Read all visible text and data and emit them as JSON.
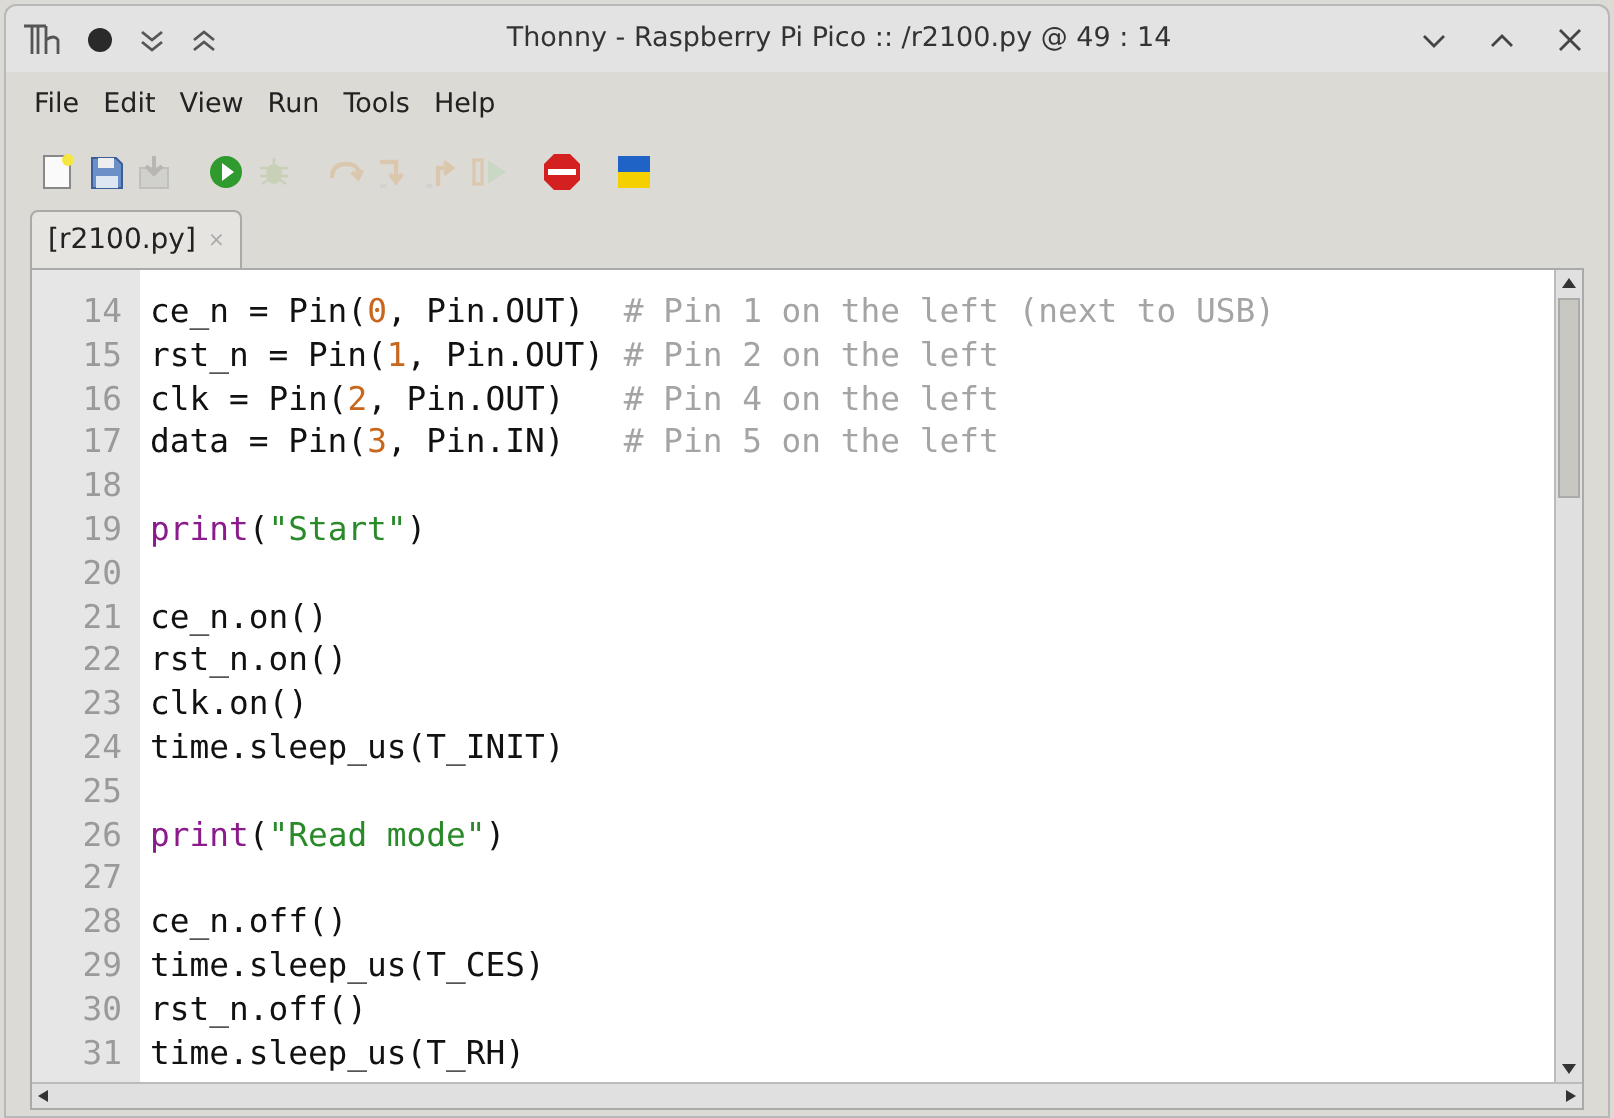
{
  "window": {
    "title": "Thonny - Raspberry Pi Pico :: /r2100.py @ 49 : 14"
  },
  "menu": [
    "File",
    "Edit",
    "View",
    "Run",
    "Tools",
    "Help"
  ],
  "toolbar": [
    {
      "kind": "new",
      "disabled": false
    },
    {
      "kind": "save",
      "disabled": false
    },
    {
      "kind": "load",
      "disabled": true
    },
    {
      "kind": "run",
      "disabled": false
    },
    {
      "kind": "debug",
      "disabled": true
    },
    {
      "kind": "step_over",
      "disabled": true
    },
    {
      "kind": "step_into",
      "disabled": true
    },
    {
      "kind": "step_out",
      "disabled": true
    },
    {
      "kind": "resume",
      "disabled": true
    },
    {
      "kind": "stop",
      "disabled": false
    },
    {
      "kind": "flag",
      "disabled": false
    }
  ],
  "tabs": [
    {
      "label": "[r2100.py]",
      "close": "×",
      "selected": true
    }
  ],
  "editor": {
    "lines": [
      {
        "number": "14",
        "tokens": [
          {
            "kind": "plain",
            "text": "ce_n = Pin("
          },
          {
            "kind": "number",
            "text": "0"
          },
          {
            "kind": "plain",
            "text": ", Pin.OUT)  "
          },
          {
            "kind": "comment",
            "text": "# Pin 1 on the left (next to USB)"
          }
        ]
      },
      {
        "number": "15",
        "tokens": [
          {
            "kind": "plain",
            "text": "rst_n = Pin("
          },
          {
            "kind": "number",
            "text": "1"
          },
          {
            "kind": "plain",
            "text": ", Pin.OUT) "
          },
          {
            "kind": "comment",
            "text": "# Pin 2 on the left"
          }
        ]
      },
      {
        "number": "16",
        "tokens": [
          {
            "kind": "plain",
            "text": "clk = Pin("
          },
          {
            "kind": "number",
            "text": "2"
          },
          {
            "kind": "plain",
            "text": ", Pin.OUT)   "
          },
          {
            "kind": "comment",
            "text": "# Pin 4 on the left"
          }
        ]
      },
      {
        "number": "17",
        "tokens": [
          {
            "kind": "plain",
            "text": "data = Pin("
          },
          {
            "kind": "number",
            "text": "3"
          },
          {
            "kind": "plain",
            "text": ", Pin.IN)   "
          },
          {
            "kind": "comment",
            "text": "# Pin 5 on the left"
          }
        ]
      },
      {
        "number": "18"
      },
      {
        "number": "19",
        "tokens": [
          {
            "kind": "builtin",
            "text": "print"
          },
          {
            "kind": "plain",
            "text": "("
          },
          {
            "kind": "string",
            "text": "\"Start\""
          },
          {
            "kind": "plain",
            "text": ")"
          }
        ]
      },
      {
        "number": "20"
      },
      {
        "number": "21",
        "tokens": [
          {
            "kind": "plain",
            "text": "ce_n.on()"
          }
        ]
      },
      {
        "number": "22",
        "tokens": [
          {
            "kind": "plain",
            "text": "rst_n.on()"
          }
        ]
      },
      {
        "number": "23",
        "tokens": [
          {
            "kind": "plain",
            "text": "clk.on()"
          }
        ]
      },
      {
        "number": "24",
        "tokens": [
          {
            "kind": "plain",
            "text": "time.sleep_us(T_INIT)"
          }
        ]
      },
      {
        "number": "25"
      },
      {
        "number": "26",
        "tokens": [
          {
            "kind": "builtin",
            "text": "print"
          },
          {
            "kind": "plain",
            "text": "("
          },
          {
            "kind": "string",
            "text": "\"Read mode\""
          },
          {
            "kind": "plain",
            "text": ")"
          }
        ]
      },
      {
        "number": "27"
      },
      {
        "number": "28",
        "tokens": [
          {
            "kind": "plain",
            "text": "ce_n.off()"
          }
        ]
      },
      {
        "number": "29",
        "tokens": [
          {
            "kind": "plain",
            "text": "time.sleep_us(T_CES)"
          }
        ]
      },
      {
        "number": "30",
        "tokens": [
          {
            "kind": "plain",
            "text": "rst_n.off()"
          }
        ]
      },
      {
        "number": "31",
        "tokens": [
          {
            "kind": "plain",
            "text": "time.sleep_us(T_RH)"
          }
        ]
      }
    ]
  }
}
